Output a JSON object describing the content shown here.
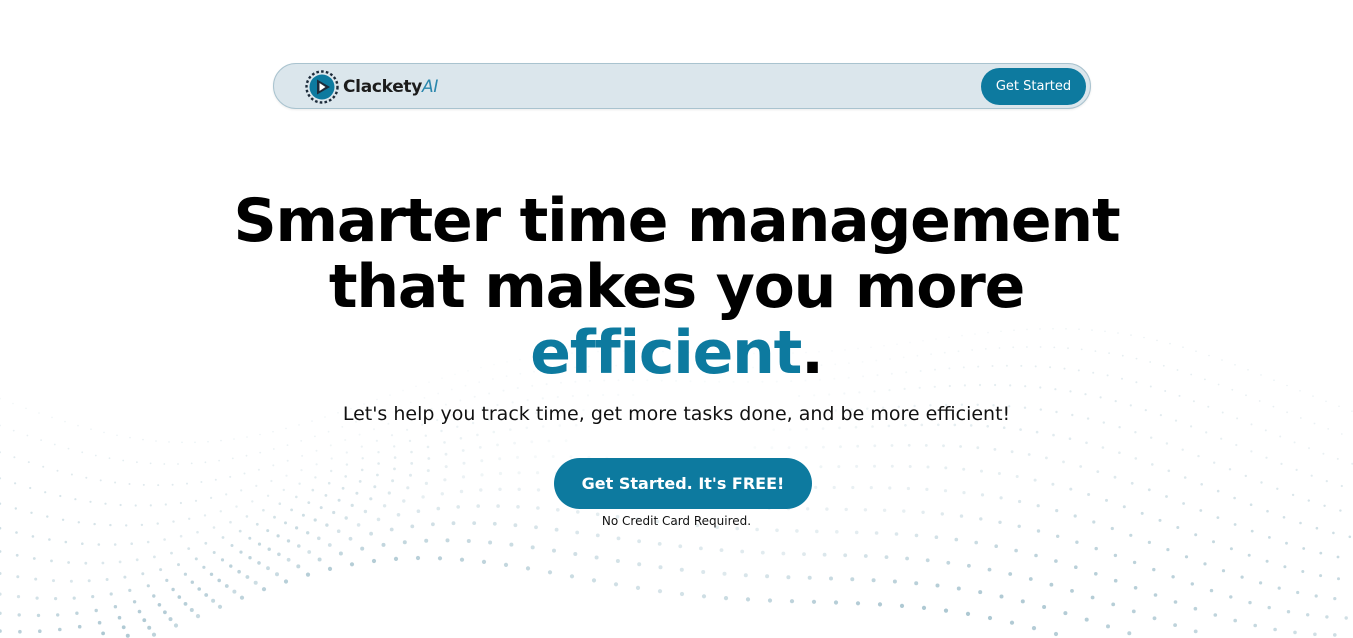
{
  "brand": {
    "name_main": "Clackety",
    "name_accent": "AI",
    "logo_icon": "play-cursor-gear-icon",
    "primary_color": "#0d7a9f"
  },
  "nav": {
    "cta_label": "Get Started"
  },
  "hero": {
    "headline_line1": "Smarter time management",
    "headline_line2": "that makes you more",
    "headline_accent": "efficient",
    "headline_end": ".",
    "subtitle": "Let's help you track time, get more tasks done, and be more efficient!",
    "cta_label": "Get Started. It's FREE!",
    "note": "No Credit Card Required."
  },
  "background": {
    "pattern": "dot-wave",
    "dot_color": "#7fa9b9"
  }
}
